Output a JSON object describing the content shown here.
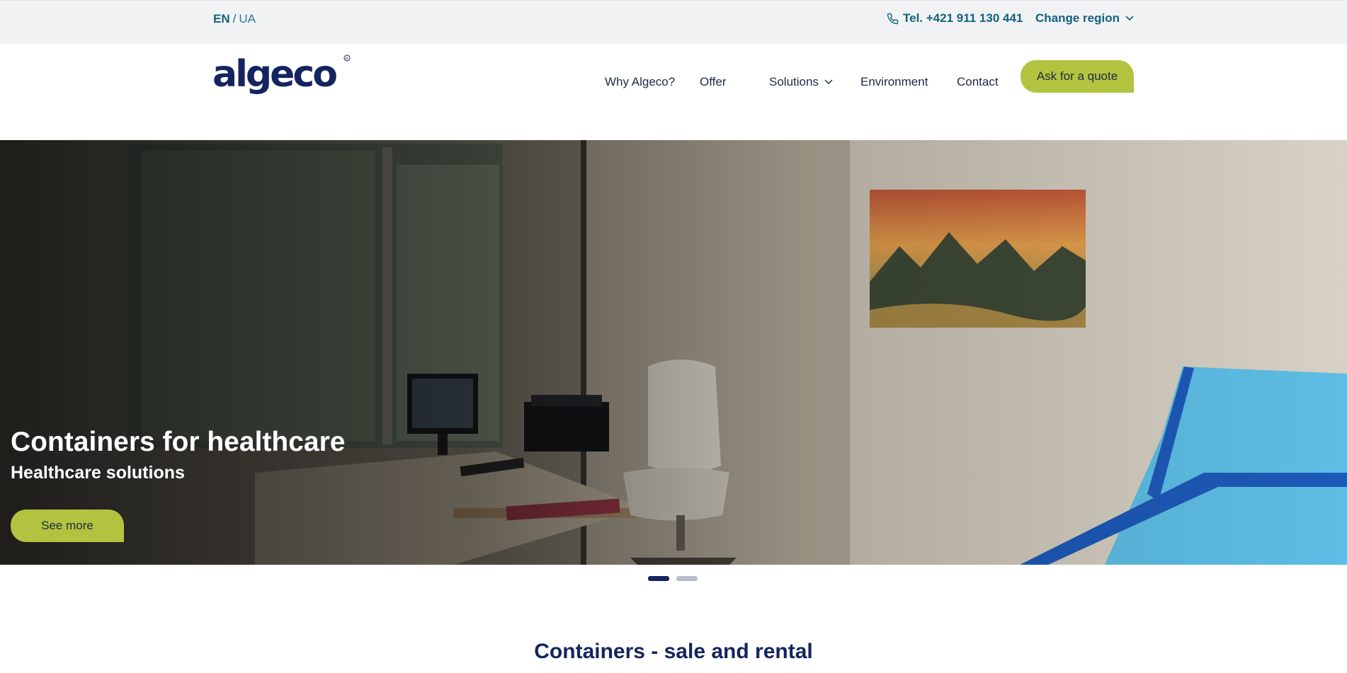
{
  "topbar": {
    "lang_active": "EN",
    "lang_separator": "/",
    "lang_other": "UA",
    "phone": "Tel. +421 911 130 441",
    "region": "Change region"
  },
  "header": {
    "logo_text": "algeco",
    "nav": {
      "why": "Why Algeco?",
      "offer": "Offer",
      "solutions": "Solutions",
      "environment": "Environment",
      "contact": "Contact"
    },
    "quote_button": "Ask for a quote"
  },
  "hero": {
    "title": "Containers for healthcare",
    "subtitle": "Healthcare solutions",
    "button": "See more",
    "slides_total": 2,
    "active_slide": 1
  },
  "section": {
    "title": "Containers - sale and rental"
  },
  "colors": {
    "brand_navy": "#14245e",
    "accent_green": "#b2c43f",
    "link_teal": "#14627f",
    "topbar_bg": "#f1f2f3"
  },
  "icons": [
    "phone-icon",
    "chevron-down-icon",
    "algeco-logo"
  ]
}
